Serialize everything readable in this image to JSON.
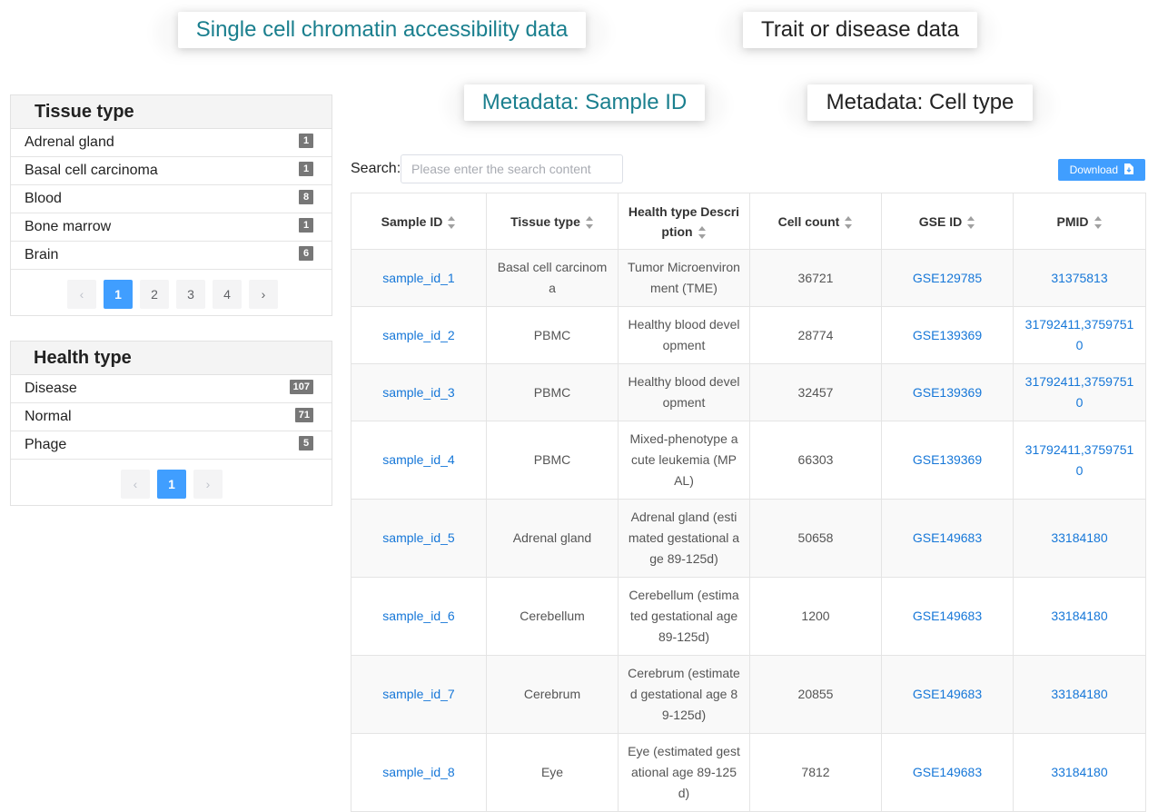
{
  "top_tabs": {
    "single_cell": "Single cell chromatin accessibility data",
    "trait": "Trait or disease data"
  },
  "meta_tabs": {
    "sample_id": "Metadata: Sample ID",
    "cell_type": "Metadata: Cell type"
  },
  "tissue_facet": {
    "title": "Tissue type",
    "items": [
      {
        "label": "Adrenal gland",
        "count": "1"
      },
      {
        "label": "Basal cell carcinoma",
        "count": "1"
      },
      {
        "label": "Blood",
        "count": "8"
      },
      {
        "label": "Bone marrow",
        "count": "1"
      },
      {
        "label": "Brain",
        "count": "6"
      }
    ],
    "pager": {
      "prev": "‹",
      "pages": [
        "1",
        "2",
        "3",
        "4"
      ],
      "next": "›",
      "active": 1
    }
  },
  "health_facet": {
    "title": "Health type",
    "items": [
      {
        "label": "Disease",
        "count": "107"
      },
      {
        "label": "Normal",
        "count": "71"
      },
      {
        "label": "Phage",
        "count": "5"
      }
    ],
    "pager": {
      "prev": "‹",
      "pages": [
        "1"
      ],
      "next": "›",
      "active": 1
    }
  },
  "search": {
    "label": "Search:",
    "placeholder": "Please enter the search content",
    "value": ""
  },
  "download": {
    "label": "Download",
    "icon": "file-download-icon"
  },
  "table": {
    "headers": [
      "Sample ID",
      "Tissue type",
      "Health type Description",
      "Cell count",
      "GSE ID",
      "PMID"
    ],
    "rows": [
      [
        "sample_id_1",
        "Basal cell carcinoma",
        "Tumor Microenvironment (TME)",
        "36721",
        "GSE129785",
        "31375813"
      ],
      [
        "sample_id_2",
        "PBMC",
        "Healthy blood development",
        "28774",
        "GSE139369",
        "31792411,37597510"
      ],
      [
        "sample_id_3",
        "PBMC",
        "Healthy blood development",
        "32457",
        "GSE139369",
        "31792411,37597510"
      ],
      [
        "sample_id_4",
        "PBMC",
        "Mixed-phenotype acute leukemia (MPAL)",
        "66303",
        "GSE139369",
        "31792411,37597510"
      ],
      [
        "sample_id_5",
        "Adrenal gland",
        "Adrenal gland (estimated gestational age 89-125d)",
        "50658",
        "GSE149683",
        "33184180"
      ],
      [
        "sample_id_6",
        "Cerebellum",
        "Cerebellum (estimated gestational age 89-125d)",
        "1200",
        "GSE149683",
        "33184180"
      ],
      [
        "sample_id_7",
        "Cerebrum",
        "Cerebrum (estimated gestational age 89-125d)",
        "20855",
        "GSE149683",
        "33184180"
      ],
      [
        "sample_id_8",
        "Eye",
        "Eye (estimated gestational age 89-125d)",
        "7812",
        "GSE149683",
        "33184180"
      ]
    ]
  },
  "colors": {
    "accent": "#409eff",
    "link": "#1677d8",
    "active_tab": "#1a7f8e",
    "badge": "#777777"
  }
}
